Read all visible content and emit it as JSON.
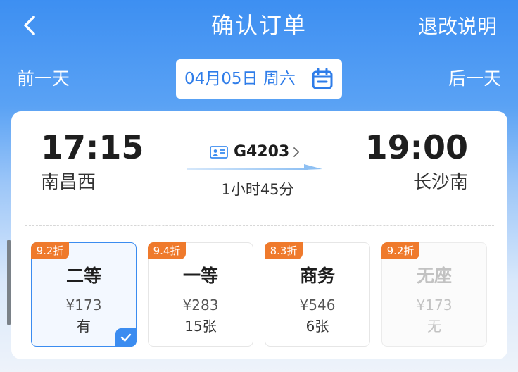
{
  "header": {
    "title": "确认订单",
    "refund_label": "退改说明"
  },
  "date_bar": {
    "prev_label": "前一天",
    "date_text": "04月05日 周六",
    "next_label": "后一天"
  },
  "trip": {
    "departure_time": "17:15",
    "departure_station": "南昌西",
    "train_number": "G4203",
    "duration": "1小时45分",
    "arrival_time": "19:00",
    "arrival_station": "长沙南"
  },
  "seats": [
    {
      "discount": "9.2折",
      "name": "二等",
      "price": "¥173",
      "availability": "有",
      "selected": true
    },
    {
      "discount": "9.4折",
      "name": "一等",
      "price": "¥283",
      "availability": "15张"
    },
    {
      "discount": "8.3折",
      "name": "商务",
      "price": "¥546",
      "availability": "6张"
    },
    {
      "discount": "9.2折",
      "name": "无座",
      "price": "¥173",
      "availability": "无",
      "sold_out": true
    }
  ],
  "colors": {
    "accent": "#3b8cf0",
    "discount_badge": "#ef7a2c",
    "header_bg": "#3d8ff2"
  }
}
